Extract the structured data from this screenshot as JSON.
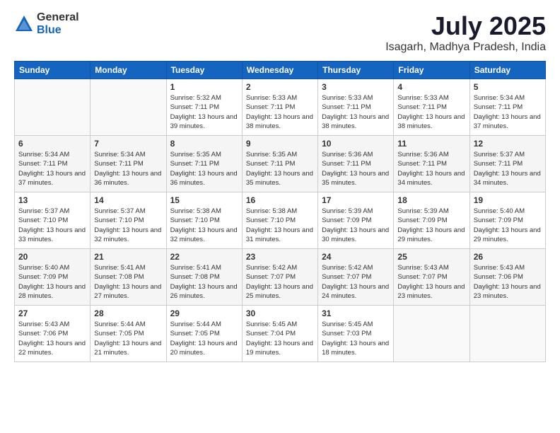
{
  "logo": {
    "general": "General",
    "blue": "Blue"
  },
  "header": {
    "month": "July 2025",
    "location": "Isagarh, Madhya Pradesh, India"
  },
  "weekdays": [
    "Sunday",
    "Monday",
    "Tuesday",
    "Wednesday",
    "Thursday",
    "Friday",
    "Saturday"
  ],
  "weeks": [
    [
      {
        "day": "",
        "info": ""
      },
      {
        "day": "",
        "info": ""
      },
      {
        "day": "1",
        "info": "Sunrise: 5:32 AM\nSunset: 7:11 PM\nDaylight: 13 hours and 39 minutes."
      },
      {
        "day": "2",
        "info": "Sunrise: 5:33 AM\nSunset: 7:11 PM\nDaylight: 13 hours and 38 minutes."
      },
      {
        "day": "3",
        "info": "Sunrise: 5:33 AM\nSunset: 7:11 PM\nDaylight: 13 hours and 38 minutes."
      },
      {
        "day": "4",
        "info": "Sunrise: 5:33 AM\nSunset: 7:11 PM\nDaylight: 13 hours and 38 minutes."
      },
      {
        "day": "5",
        "info": "Sunrise: 5:34 AM\nSunset: 7:11 PM\nDaylight: 13 hours and 37 minutes."
      }
    ],
    [
      {
        "day": "6",
        "info": "Sunrise: 5:34 AM\nSunset: 7:11 PM\nDaylight: 13 hours and 37 minutes."
      },
      {
        "day": "7",
        "info": "Sunrise: 5:34 AM\nSunset: 7:11 PM\nDaylight: 13 hours and 36 minutes."
      },
      {
        "day": "8",
        "info": "Sunrise: 5:35 AM\nSunset: 7:11 PM\nDaylight: 13 hours and 36 minutes."
      },
      {
        "day": "9",
        "info": "Sunrise: 5:35 AM\nSunset: 7:11 PM\nDaylight: 13 hours and 35 minutes."
      },
      {
        "day": "10",
        "info": "Sunrise: 5:36 AM\nSunset: 7:11 PM\nDaylight: 13 hours and 35 minutes."
      },
      {
        "day": "11",
        "info": "Sunrise: 5:36 AM\nSunset: 7:11 PM\nDaylight: 13 hours and 34 minutes."
      },
      {
        "day": "12",
        "info": "Sunrise: 5:37 AM\nSunset: 7:11 PM\nDaylight: 13 hours and 34 minutes."
      }
    ],
    [
      {
        "day": "13",
        "info": "Sunrise: 5:37 AM\nSunset: 7:10 PM\nDaylight: 13 hours and 33 minutes."
      },
      {
        "day": "14",
        "info": "Sunrise: 5:37 AM\nSunset: 7:10 PM\nDaylight: 13 hours and 32 minutes."
      },
      {
        "day": "15",
        "info": "Sunrise: 5:38 AM\nSunset: 7:10 PM\nDaylight: 13 hours and 32 minutes."
      },
      {
        "day": "16",
        "info": "Sunrise: 5:38 AM\nSunset: 7:10 PM\nDaylight: 13 hours and 31 minutes."
      },
      {
        "day": "17",
        "info": "Sunrise: 5:39 AM\nSunset: 7:09 PM\nDaylight: 13 hours and 30 minutes."
      },
      {
        "day": "18",
        "info": "Sunrise: 5:39 AM\nSunset: 7:09 PM\nDaylight: 13 hours and 29 minutes."
      },
      {
        "day": "19",
        "info": "Sunrise: 5:40 AM\nSunset: 7:09 PM\nDaylight: 13 hours and 29 minutes."
      }
    ],
    [
      {
        "day": "20",
        "info": "Sunrise: 5:40 AM\nSunset: 7:09 PM\nDaylight: 13 hours and 28 minutes."
      },
      {
        "day": "21",
        "info": "Sunrise: 5:41 AM\nSunset: 7:08 PM\nDaylight: 13 hours and 27 minutes."
      },
      {
        "day": "22",
        "info": "Sunrise: 5:41 AM\nSunset: 7:08 PM\nDaylight: 13 hours and 26 minutes."
      },
      {
        "day": "23",
        "info": "Sunrise: 5:42 AM\nSunset: 7:07 PM\nDaylight: 13 hours and 25 minutes."
      },
      {
        "day": "24",
        "info": "Sunrise: 5:42 AM\nSunset: 7:07 PM\nDaylight: 13 hours and 24 minutes."
      },
      {
        "day": "25",
        "info": "Sunrise: 5:43 AM\nSunset: 7:07 PM\nDaylight: 13 hours and 23 minutes."
      },
      {
        "day": "26",
        "info": "Sunrise: 5:43 AM\nSunset: 7:06 PM\nDaylight: 13 hours and 23 minutes."
      }
    ],
    [
      {
        "day": "27",
        "info": "Sunrise: 5:43 AM\nSunset: 7:06 PM\nDaylight: 13 hours and 22 minutes."
      },
      {
        "day": "28",
        "info": "Sunrise: 5:44 AM\nSunset: 7:05 PM\nDaylight: 13 hours and 21 minutes."
      },
      {
        "day": "29",
        "info": "Sunrise: 5:44 AM\nSunset: 7:05 PM\nDaylight: 13 hours and 20 minutes."
      },
      {
        "day": "30",
        "info": "Sunrise: 5:45 AM\nSunset: 7:04 PM\nDaylight: 13 hours and 19 minutes."
      },
      {
        "day": "31",
        "info": "Sunrise: 5:45 AM\nSunset: 7:03 PM\nDaylight: 13 hours and 18 minutes."
      },
      {
        "day": "",
        "info": ""
      },
      {
        "day": "",
        "info": ""
      }
    ]
  ]
}
